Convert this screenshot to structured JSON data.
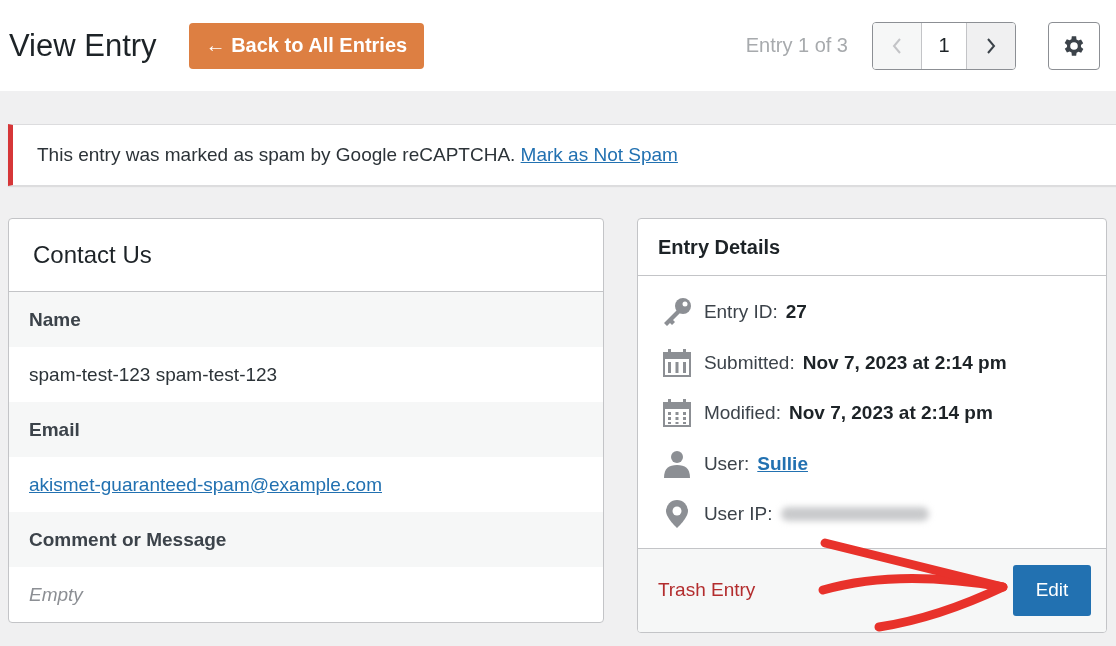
{
  "header": {
    "title": "View Entry",
    "back_button": "← Back to All Entries",
    "entry_count": "Entry 1 of 3",
    "pager": {
      "prev_disabled": true,
      "current": "1",
      "next_disabled": false
    }
  },
  "notice": {
    "text": "This entry was marked as spam by Google reCAPTCHA.",
    "link": "Mark as Not Spam"
  },
  "form_card": {
    "title": "Contact Us",
    "fields": [
      {
        "label": "Name",
        "value": "spam-test-123 spam-test-123",
        "link": false,
        "empty": false
      },
      {
        "label": "Email",
        "value": "akismet-guaranteed-spam@example.com",
        "link": true,
        "empty": false
      },
      {
        "label": "Comment or Message",
        "value": "Empty",
        "link": false,
        "empty": true
      }
    ]
  },
  "details_card": {
    "title": "Entry Details",
    "rows": [
      {
        "kind": "key",
        "label": "Entry ID:",
        "value": "27",
        "link": false
      },
      {
        "kind": "calendar",
        "label": "Submitted:",
        "value": "Nov 7, 2023 at 2:14 pm",
        "link": false
      },
      {
        "kind": "calendar-grid",
        "label": "Modified:",
        "value": "Nov 7, 2023 at 2:14 pm",
        "link": false
      },
      {
        "kind": "user",
        "label": "User:",
        "value": "Sullie",
        "link": true
      },
      {
        "kind": "pin",
        "label": "User IP:",
        "redacted": true
      }
    ],
    "trash": "Trash Entry",
    "edit": "Edit"
  }
}
